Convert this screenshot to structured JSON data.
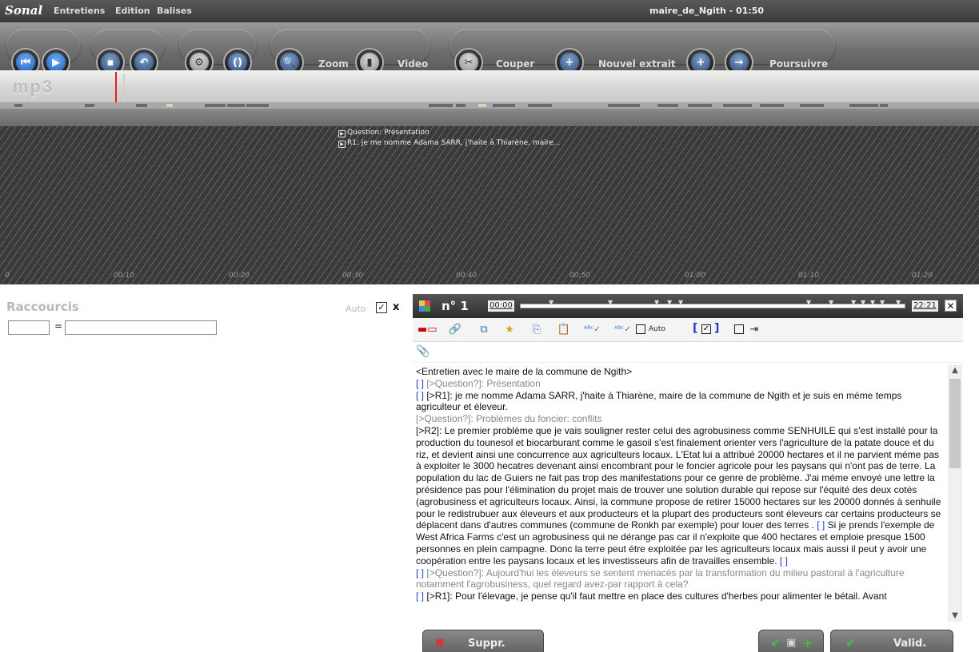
{
  "app": {
    "logo": "Sonal",
    "menus": [
      "Entretiens",
      "Edition",
      "Balises"
    ],
    "window_title": "maire_de_Ngith - 01:50"
  },
  "toolbar": {
    "zoom_label": "Zoom",
    "video_label": "Video",
    "cut_label": "Couper",
    "new_extract_label": "Nouvel extrait",
    "continue_label": "Poursuivre"
  },
  "player": {
    "format_label": "mp3",
    "segments": [
      "Question: Présentation",
      "R1: je me nomme Adama SARR, j'haite à Thiarène, maire..."
    ],
    "timeline_ticks": [
      "00:10",
      "00:20",
      "00:30",
      "00:40",
      "00:50",
      "01:00",
      "01:10",
      "01:20"
    ],
    "first_tick_partial": "0"
  },
  "shortcuts": {
    "title": "Raccourcis",
    "auto_label": "Auto",
    "auto_checked": true,
    "close_label": "x",
    "equals": "=",
    "key_value": "",
    "text_value": ""
  },
  "editor": {
    "extract_number": "n° 1",
    "start_time": "00:00",
    "end_time": "22:21",
    "close": "✕",
    "auto_label": "Auto",
    "bracket_label": "[",
    "bracket_close": "]",
    "paragraphs": [
      {
        "style": "plain",
        "text": "<Entretien avec le maire de la commune de Ngith>"
      },
      {
        "style": "tag",
        "tag": "[ ]",
        "text": "[>Question?]: Présentation"
      },
      {
        "style": "tagplain",
        "tag": "[ ]",
        "text": "[>R1]: je me nomme Adama SARR, j'haite à Thiarène, maire de la commune de Ngith et je suis en méme temps agriculteur et éleveur."
      },
      {
        "style": "q",
        "text": "[>Question?]: Problèmes du foncier: conflits"
      },
      {
        "style": "plain",
        "text": "[>R2]: Le premier problème que je vais souligner rester celui des agrobusiness comme SENHUILE qui s'est installé pour la production du tounesol et biocarburant comme le gasoil s'est finalement orienter vers l'agriculture de la patate douce et du riz, et devient ainsi une concurrence aux agriculteurs locaux. L'Etat lui a attribué 20000 hectares et il ne parvient méme pas à exploiter le 3000 hecatres devenant ainsi encombrant pour le foncier agricole pour les paysans qui n'ont pas de terre. La population du lac de Guiers ne fait pas trop des manifestations pour ce genre de problème. J'ai méme envoyé une lettre la présidence pas pour l'élimination du projet mais de trouver une solution durable qui repose sur l'équité des deux cotés (agrobusiness et agriculteurs locaux.  Ainsi, la commune propose de retirer 15000 hectares sur les 20000 donnés à senhuile pour le redistrubuer aux éleveurs et aux producteurs et la plupart des producteurs sont éleveurs car certains producteurs se déplacent dans d'autres communes (commune de Ronkh par exemple) pour louer des terres ."
      },
      {
        "style": "plain",
        "text": "Si je prends l'exemple de West Africa Farms c'est un agrobusiness qui ne dérange pas car il n'exploite que 400 hectares et emploie presque 1500 personnes en plein campagne. Donc la terre peut étre exploitée par les agriculteurs locaux mais aussi il peut y avoir une coopération entre les paysans locaux et les investisseurs afin de travailles ensemble."
      },
      {
        "style": "tag",
        "tag": "[ ]",
        "text": "[>Question?]: Aujourd'hui les éleveurs se sentent menacés par la transformation du milieu pastoral à l'agriculture notamment l'agrobusiness, quel regard avez-par rapport à cela?"
      },
      {
        "style": "tagplain",
        "tag": "[ ]",
        "text": "[>R1]: Pour l'élevage, je pense qu'il faut mettre en place des cultures d'herbes pour alimenter le bétail. Avant"
      }
    ],
    "inline_tag": "[ ]",
    "delete_label": "Suppr.",
    "validate_label": "Valid."
  },
  "colors": {
    "tag_blue": "#1a35d8",
    "question_gray": "#888888",
    "cursor_red": "#e02020",
    "delete_red": "#e03030",
    "check_green": "#3fbf3f"
  },
  "icons": [
    "first-icon",
    "play-icon",
    "save-icon",
    "undo-icon",
    "settings-icon",
    "bracket-icon",
    "zoom-icon",
    "video-icon",
    "scissors-icon",
    "new-extract-icon",
    "insert-extract-icon",
    "continue-icon"
  ]
}
